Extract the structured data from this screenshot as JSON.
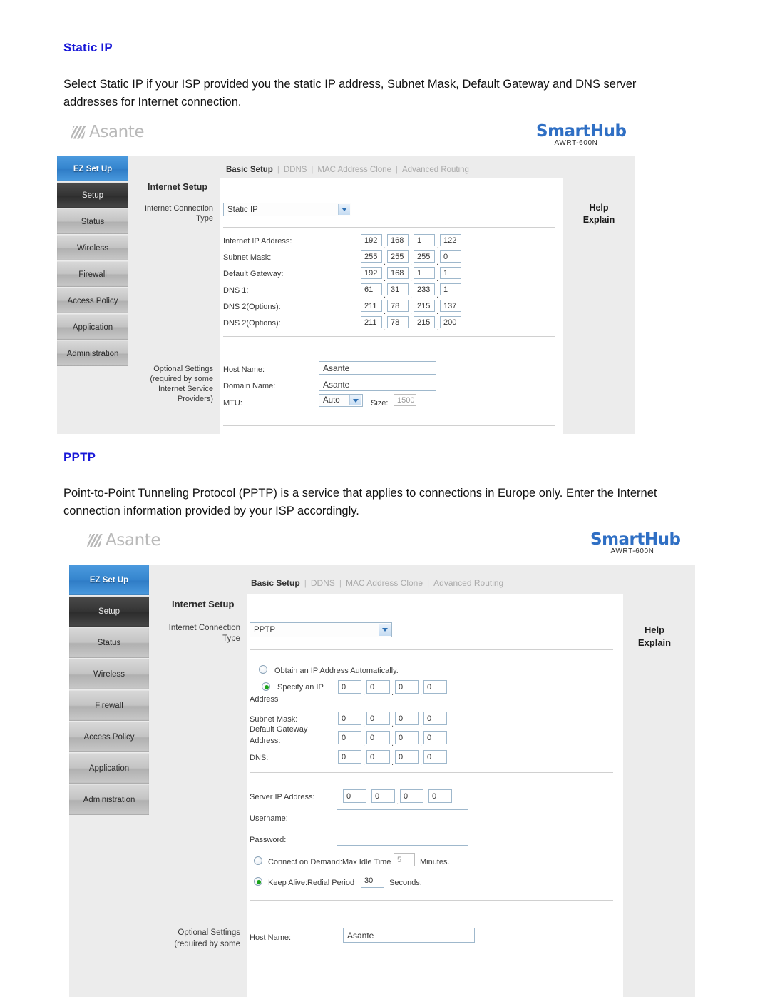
{
  "document": {
    "section1": {
      "heading": "Static IP",
      "paragraph": "Select Static IP if your ISP provided you the static IP address, Subnet Mask, Default Gateway and DNS server addresses for Internet connection."
    },
    "section2": {
      "heading": "PPTP",
      "paragraph": "Point-to-Point Tunneling Protocol (PPTP) is a service that applies to connections in Europe only. Enter the Internet connection information provided by your ISP accordingly."
    }
  },
  "branding": {
    "vendor": "Asante",
    "product": "SmartHub",
    "model": "AWRT-600N",
    "vendor_color": "#b9b9b9",
    "product_color": "#2f6fc4"
  },
  "router_ui": {
    "sidebar": {
      "items": [
        {
          "label": "EZ Set Up",
          "state": "active-blue"
        },
        {
          "label": "Setup",
          "state": "active-dark"
        },
        {
          "label": "Status",
          "state": "normal"
        },
        {
          "label": "Wireless",
          "state": "normal"
        },
        {
          "label": "Firewall",
          "state": "normal"
        },
        {
          "label": "Access Policy",
          "state": "normal"
        },
        {
          "label": "Application",
          "state": "normal"
        },
        {
          "label": "Administration",
          "state": "normal"
        }
      ]
    },
    "topnav": {
      "current": "Basic Setup",
      "separator": "|",
      "links": [
        "DDNS",
        "MAC Address Clone",
        "Advanced Routing"
      ]
    },
    "help": {
      "line1": "Help",
      "line2": "Explain"
    },
    "section_title": "Internet Setup",
    "connection_type_label_line1": "Internet Connection",
    "connection_type_label_line2": "Type"
  },
  "panel_static": {
    "connection_type": "Static IP",
    "fields": [
      {
        "label": "Internet IP Address:",
        "octets": [
          "192",
          "168",
          "1",
          "122"
        ]
      },
      {
        "label": "Subnet Mask:",
        "octets": [
          "255",
          "255",
          "255",
          "0"
        ]
      },
      {
        "label": "Default Gateway:",
        "octets": [
          "192",
          "168",
          "1",
          "1"
        ]
      },
      {
        "label": "DNS 1:",
        "octets": [
          "61",
          "31",
          "233",
          "1"
        ]
      },
      {
        "label": "DNS 2(Options):",
        "octets": [
          "211",
          "78",
          "215",
          "137"
        ]
      },
      {
        "label": "DNS 2(Options):",
        "octets": [
          "211",
          "78",
          "215",
          "200"
        ]
      }
    ],
    "optional": {
      "label_lines": [
        "Optional Settings",
        "(required by some",
        "Internet Service",
        "Providers)"
      ],
      "host_name_label": "Host Name:",
      "host_name_value": "Asante",
      "domain_name_label": "Domain Name:",
      "domain_name_value": "Asante",
      "mtu_label": "MTU:",
      "mtu_value": "Auto",
      "size_label": "Size:",
      "size_value": "1500"
    }
  },
  "panel_pptp": {
    "connection_type": "PPTP",
    "radio_auto_label": "Obtain an IP Address Automatically.",
    "radio_auto_selected": false,
    "radio_specify_label_line1": "Specify an IP",
    "radio_specify_label_line2": "Address",
    "radio_specify_selected": true,
    "ip_rows": [
      {
        "label": "",
        "octets": [
          "0",
          "0",
          "0",
          "0"
        ]
      },
      {
        "label": "Subnet Mask:",
        "octets": [
          "0",
          "0",
          "0",
          "0"
        ]
      },
      {
        "label": "Default Gateway Address:",
        "octets": [
          "0",
          "0",
          "0",
          "0"
        ]
      },
      {
        "label": "DNS:",
        "octets": [
          "0",
          "0",
          "0",
          "0"
        ]
      }
    ],
    "gateway_label_line1": "Default Gateway",
    "gateway_label_line2": "Address:",
    "server_ip_label": "Server IP Address:",
    "server_ip_octets": [
      "0",
      "0",
      "0",
      "0"
    ],
    "username_label": "Username:",
    "username_value": "",
    "password_label": "Password:",
    "password_value": "",
    "connect_demand_label_a": "Connect on Demand:Max Idle Time",
    "connect_demand_value": "5",
    "connect_demand_label_b": "Minutes.",
    "connect_demand_selected": false,
    "keep_alive_label_a": "Keep Alive:Redial Period",
    "keep_alive_value": "30",
    "keep_alive_label_b": "Seconds.",
    "keep_alive_selected": true,
    "optional": {
      "label_lines": [
        "Optional Settings",
        "(required by some"
      ],
      "host_name_label": "Host Name:",
      "host_name_value": "Asante"
    }
  }
}
